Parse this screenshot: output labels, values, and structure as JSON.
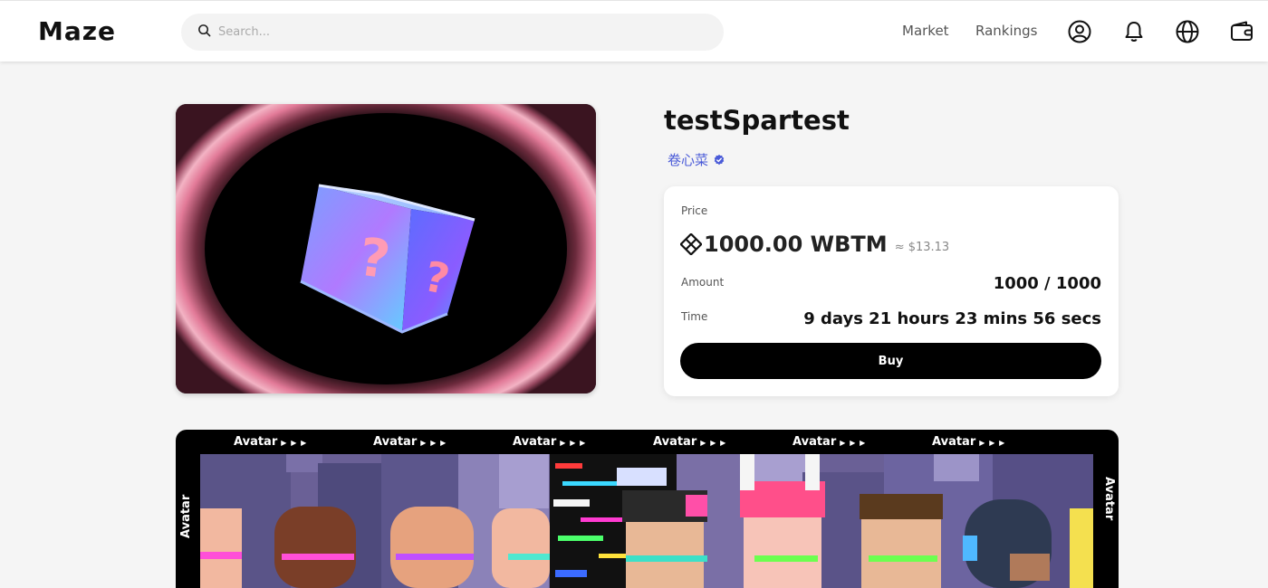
{
  "header": {
    "logo": "Maze",
    "search_placeholder": "Search...",
    "nav": {
      "market": "Market",
      "rankings": "Rankings"
    }
  },
  "item": {
    "title": "testSpartest",
    "creator": "卷心菜"
  },
  "price_card": {
    "price_label": "Price",
    "price": "1000.00 WBTM",
    "price_usd": "≈ $13.13",
    "amount_label": "Amount",
    "amount": "1000 / 1000",
    "time_label": "Time",
    "time": "9 days 21 hours 23 mins 56 secs",
    "buy_label": "Buy"
  },
  "banner": {
    "tag_label": "Avatar",
    "tag_arrows": "▶ ▶ ▶"
  },
  "colors": {
    "accent_creator": "#4a5bd8",
    "verified_badge": "#4a5bd8",
    "buy_button": "#000000",
    "page_bg": "#f5f5f5"
  },
  "icons": [
    "search-icon",
    "user-icon",
    "bell-icon",
    "globe-icon",
    "wallet-icon",
    "verified-icon",
    "wbtm-token-icon"
  ]
}
